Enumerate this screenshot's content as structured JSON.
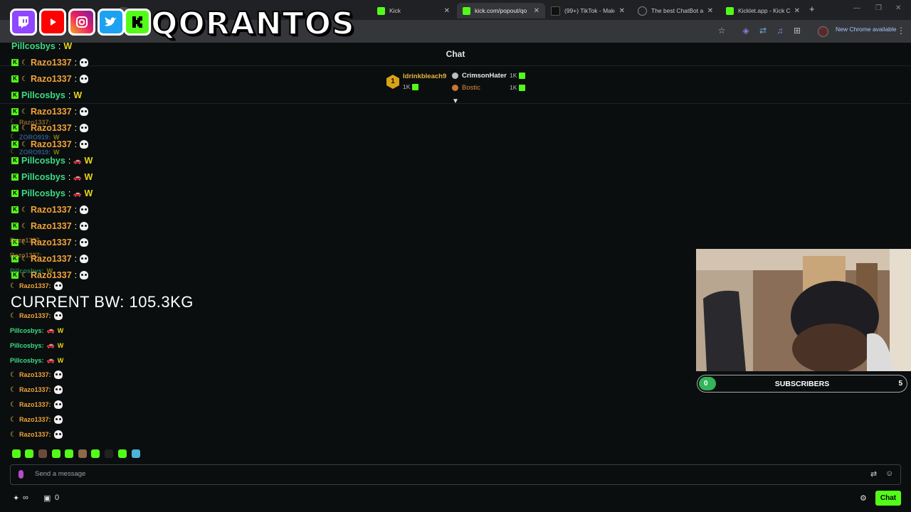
{
  "browser": {
    "tabs": [
      {
        "label": "",
        "active": false
      },
      {
        "label": "Kick",
        "active": false
      },
      {
        "label": "kick.com/popout/qo",
        "active": true
      },
      {
        "label": "(99+) TikTok - Make Y",
        "active": false
      },
      {
        "label": "The best ChatBot an",
        "active": false
      },
      {
        "label": "Kicklet.app - Kick Ch",
        "active": false
      }
    ],
    "new_chrome": "New Chrome available"
  },
  "overlay": {
    "brand": "QORANTOS",
    "current_bw": "CURRENT BW: 105.3KG"
  },
  "chat": {
    "title": "Chat",
    "leaderboard": {
      "first": {
        "rank": "1",
        "name": "ldrinkbleach9",
        "count": "1K"
      },
      "second": {
        "name": "CrimsonHater",
        "count": "1K"
      },
      "third": {
        "name": "Bostic",
        "count": "1K"
      }
    },
    "messages": [
      {
        "user": "Pillcosbys",
        "sep": ":"
      },
      {
        "user": "Razo1337",
        "sep": ":"
      },
      {
        "user": "Razo1337",
        "sep": ":"
      },
      {
        "user": "Pillcosbys",
        "sep": ":"
      },
      {
        "user": "Razo1337",
        "sep": ":"
      },
      {
        "user": "Razo1337",
        "sep": ":"
      },
      {
        "user": "Razo1337",
        "sep": ":"
      },
      {
        "user": "Pillcosbys",
        "sep": ":"
      },
      {
        "user": "Pillcosbys",
        "sep": ":"
      },
      {
        "user": "Pillcosbys",
        "sep": ":"
      },
      {
        "user": "Razo1337",
        "sep": ":"
      },
      {
        "user": "Razo1337",
        "sep": ":"
      },
      {
        "user": "Razo1337",
        "sep": ":"
      },
      {
        "user": "Razo1337",
        "sep": ":"
      },
      {
        "user": "Razo1337",
        "sep": ":"
      }
    ],
    "small_messages": [
      {
        "user": "Razo1337:"
      },
      {
        "user": "Razo1337:"
      },
      {
        "user": "Pillcosbys:"
      },
      {
        "user": "Pillcosbys:"
      },
      {
        "user": "Pillcosbys:"
      },
      {
        "user": "Razo1337:"
      },
      {
        "user": "Razo1337:"
      },
      {
        "user": "Razo1337:"
      },
      {
        "user": "Razo1337:"
      },
      {
        "user": "Razo1337:"
      }
    ],
    "ghost_users": [
      "Razo1337:",
      "ZORO919:",
      "ZORO919:",
      "Razo1337",
      "Razo1337:",
      "Pillcosbys:"
    ],
    "emote_w": "W",
    "input_placeholder": "Send a message",
    "send_label": "Chat",
    "viewer_count": "0"
  },
  "subs": {
    "label": "SUBSCRIBERS",
    "current": "0",
    "goal": "5",
    "progress": 0.0
  },
  "colors": {
    "kick_green": "#53fc18",
    "razo": "#f2a33a",
    "pillcosbys": "#3ddc84",
    "zoro": "#4a90e2"
  }
}
